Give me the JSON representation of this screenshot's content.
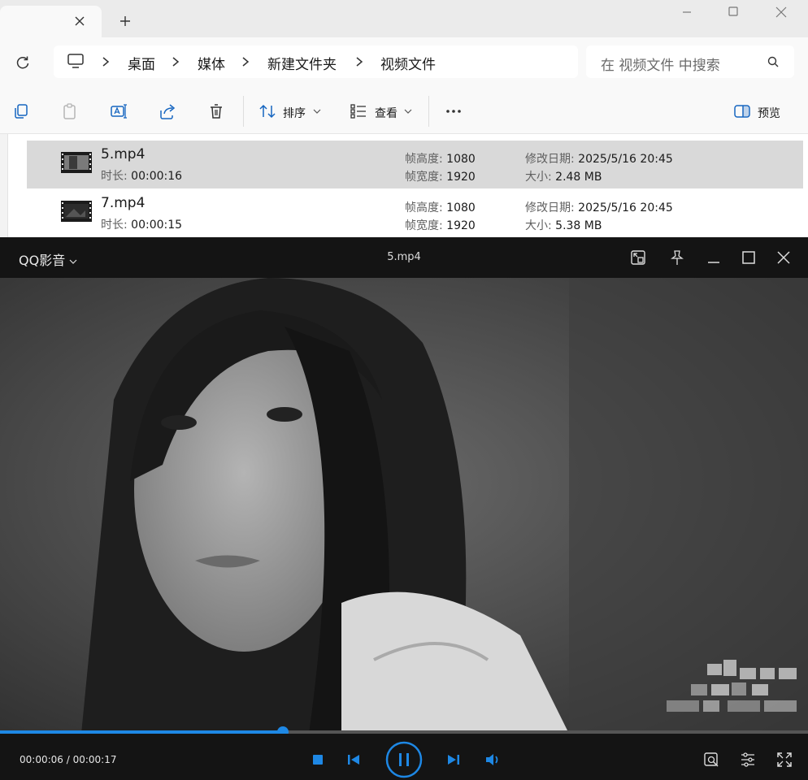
{
  "explorer": {
    "tab_close_icon": "close-icon",
    "new_tab_icon": "plus-icon",
    "window_controls": [
      "minimize-icon",
      "maximize-icon",
      "close-icon"
    ],
    "breadcrumb": [
      "桌面",
      "媒体",
      "新建文件夹",
      "视频文件"
    ],
    "search": {
      "placeholder": "在 视频文件 中搜索"
    },
    "toolbar": {
      "sort_label": "排序",
      "view_label": "查看",
      "preview_label": "预览"
    },
    "files": [
      {
        "name": "5.mp4",
        "duration_label": "时长:",
        "duration": "00:00:16",
        "height_label": "帧高度:",
        "height": "1080",
        "width_label": "帧宽度:",
        "width": "1920",
        "modified_label": "修改日期:",
        "modified": "2025/5/16 20:45",
        "size_label": "大小:",
        "size": "2.48 MB",
        "selected": true
      },
      {
        "name": "7.mp4",
        "duration_label": "时长:",
        "duration": "00:00:15",
        "height_label": "帧高度:",
        "height": "1080",
        "width_label": "帧宽度:",
        "width": "1920",
        "modified_label": "修改日期:",
        "modified": "2025/5/16 20:45",
        "size_label": "大小:",
        "size": "5.38 MB",
        "selected": false
      }
    ]
  },
  "player": {
    "brand": "QQ影音",
    "title": "5.mp4",
    "current_time": "00:00:06",
    "total_time": "00:00:17",
    "time_display": "00:00:06 / 00:00:17",
    "progress": 0.35,
    "accent_color": "#1e88e5"
  }
}
